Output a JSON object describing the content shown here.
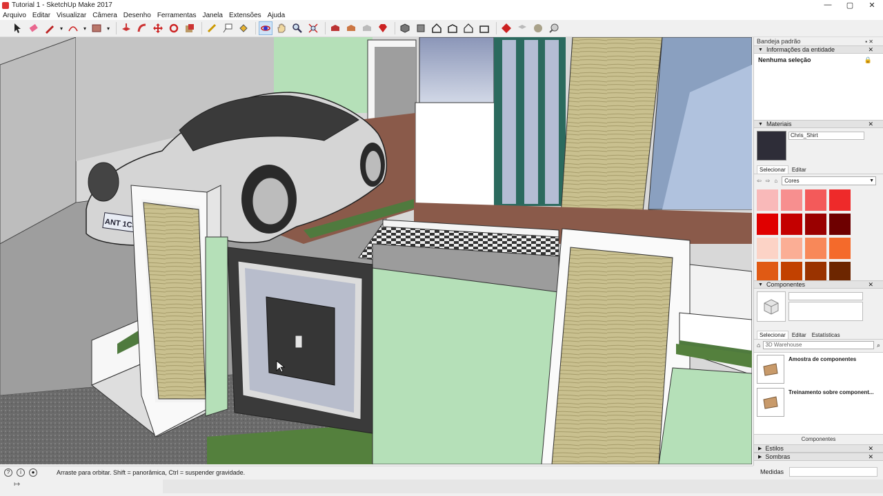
{
  "window": {
    "title": "Tutorial 1 - SketchUp Make 2017",
    "min": "—",
    "max": "▢",
    "close": "✕"
  },
  "menu": [
    "Arquivo",
    "Editar",
    "Visualizar",
    "Câmera",
    "Desenho",
    "Ferramentas",
    "Janela",
    "Extensões",
    "Ajuda"
  ],
  "viewport": {
    "plate_text": "ANT 1CS"
  },
  "tray": {
    "title": "Bandeja padrão",
    "entity": {
      "header": "Informações da entidade",
      "value": "Nenhuma seleção"
    },
    "materials": {
      "header": "Materiais",
      "name": "Chris_Shirt",
      "tab_select": "Selecionar",
      "tab_edit": "Editar",
      "collection": "Cores",
      "swatch_color": "#2e2d38",
      "colors": [
        "#f9b9b9",
        "#f78f8f",
        "#f35a5a",
        "#ee2a2a",
        "#e00000",
        "#c40000",
        "#9a0000",
        "#6e0000",
        "#fcd3c6",
        "#fbae95",
        "#f88859",
        "#f46a2b",
        "#e05a14",
        "#c24100",
        "#9a3300",
        "#6d2600"
      ]
    },
    "components": {
      "header": "Componentes",
      "tab_select": "Selecionar",
      "tab_edit": "Editar",
      "tab_stats": "Estatísticas",
      "search_placeholder": "3D Warehouse",
      "items": [
        "Amostra de componentes",
        "Treinamento sobre component..."
      ],
      "footer": "Componentes"
    },
    "styles_header": "Estilos",
    "shadows_header": "Sombras"
  },
  "status": {
    "message": "Arraste para orbitar. Shift = panorâmica, Ctrl = suspender gravidade.",
    "measurements_label": "Medidas"
  }
}
